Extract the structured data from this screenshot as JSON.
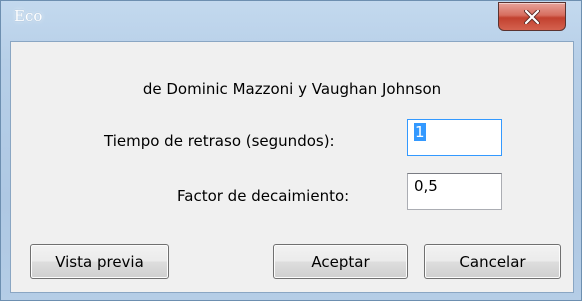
{
  "window": {
    "title": "Eco",
    "close_icon": "close-icon"
  },
  "dialog": {
    "author_text": "de Dominic Mazzoni y Vaughan Johnson",
    "delay": {
      "label": "Tiempo de retraso (segundos):",
      "value": "1"
    },
    "decay": {
      "label": "Factor de decaimiento:",
      "value": "0,5"
    }
  },
  "buttons": {
    "preview_label": "Vista previa",
    "ok_label": "Aceptar",
    "cancel_label": "Cancelar"
  },
  "colors": {
    "title_gradient": "#b7cfe8",
    "close_button": "#c2412f",
    "client_bg": "#f0f0f0",
    "selection": "#3399ff"
  }
}
